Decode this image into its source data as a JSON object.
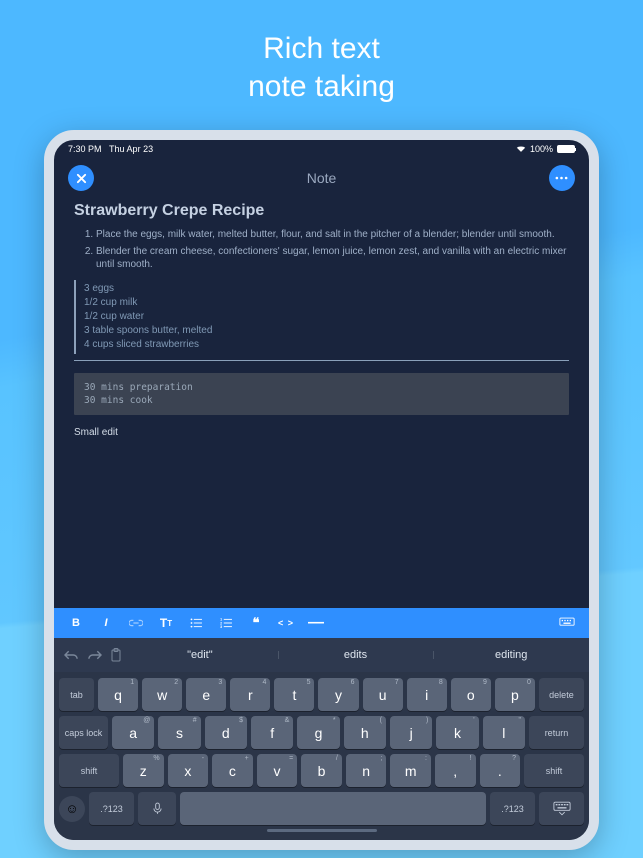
{
  "hero": {
    "line1": "Rich text",
    "line2": "note taking"
  },
  "statusbar": {
    "time": "7:30 PM",
    "date": "Thu Apr 23",
    "battery": "100%"
  },
  "navbar": {
    "title": "Note"
  },
  "note": {
    "title": "Strawberry Crepe Recipe",
    "steps": [
      "Place the eggs, milk water, melted butter, flour, and salt in the pitcher of a blender; blender until smooth.",
      "Blender the cream cheese, confectioners' sugar, lemon juice, lemon zest, and vanilla with an electric mixer until smooth."
    ],
    "ingredients": [
      "3 eggs",
      "1/2 cup milk",
      "1/2 cup water",
      "3 table spoons butter, melted",
      "4 cups sliced strawberries"
    ],
    "code": "30 mins preparation\n30 mins cook",
    "small": "Small edit"
  },
  "toolbar": {
    "bold": "B",
    "italic": "I",
    "link": "link",
    "textsize": "Tt",
    "ul": "ul",
    "ol": "ol",
    "quote": "❝",
    "code": "< >",
    "hr": "—",
    "kbd": "kbd"
  },
  "predictive": {
    "s1": "\"edit\"",
    "s2": "edits",
    "s3": "editing"
  },
  "keyboard": {
    "row1": [
      {
        "main": "q",
        "sub": "1"
      },
      {
        "main": "w",
        "sub": "2"
      },
      {
        "main": "e",
        "sub": "3"
      },
      {
        "main": "r",
        "sub": "4"
      },
      {
        "main": "t",
        "sub": "5"
      },
      {
        "main": "y",
        "sub": "6"
      },
      {
        "main": "u",
        "sub": "7"
      },
      {
        "main": "i",
        "sub": "8"
      },
      {
        "main": "o",
        "sub": "9"
      },
      {
        "main": "p",
        "sub": "0"
      }
    ],
    "row2": [
      {
        "main": "a",
        "sub": "@"
      },
      {
        "main": "s",
        "sub": "#"
      },
      {
        "main": "d",
        "sub": "$"
      },
      {
        "main": "f",
        "sub": "&"
      },
      {
        "main": "g",
        "sub": "*"
      },
      {
        "main": "h",
        "sub": "("
      },
      {
        "main": "j",
        "sub": ")"
      },
      {
        "main": "k",
        "sub": "'"
      },
      {
        "main": "l",
        "sub": "\""
      }
    ],
    "row3": [
      {
        "main": "z",
        "sub": "%"
      },
      {
        "main": "x",
        "sub": "-"
      },
      {
        "main": "c",
        "sub": "+"
      },
      {
        "main": "v",
        "sub": "="
      },
      {
        "main": "b",
        "sub": "/"
      },
      {
        "main": "n",
        "sub": ";"
      },
      {
        "main": "m",
        "sub": ":"
      },
      {
        "main": ",",
        "sub": "!"
      },
      {
        "main": ".",
        "sub": "?"
      }
    ],
    "tab": "tab",
    "delete": "delete",
    "caps": "caps lock",
    "return": "return",
    "shift": "shift",
    "sym": ".?123"
  }
}
